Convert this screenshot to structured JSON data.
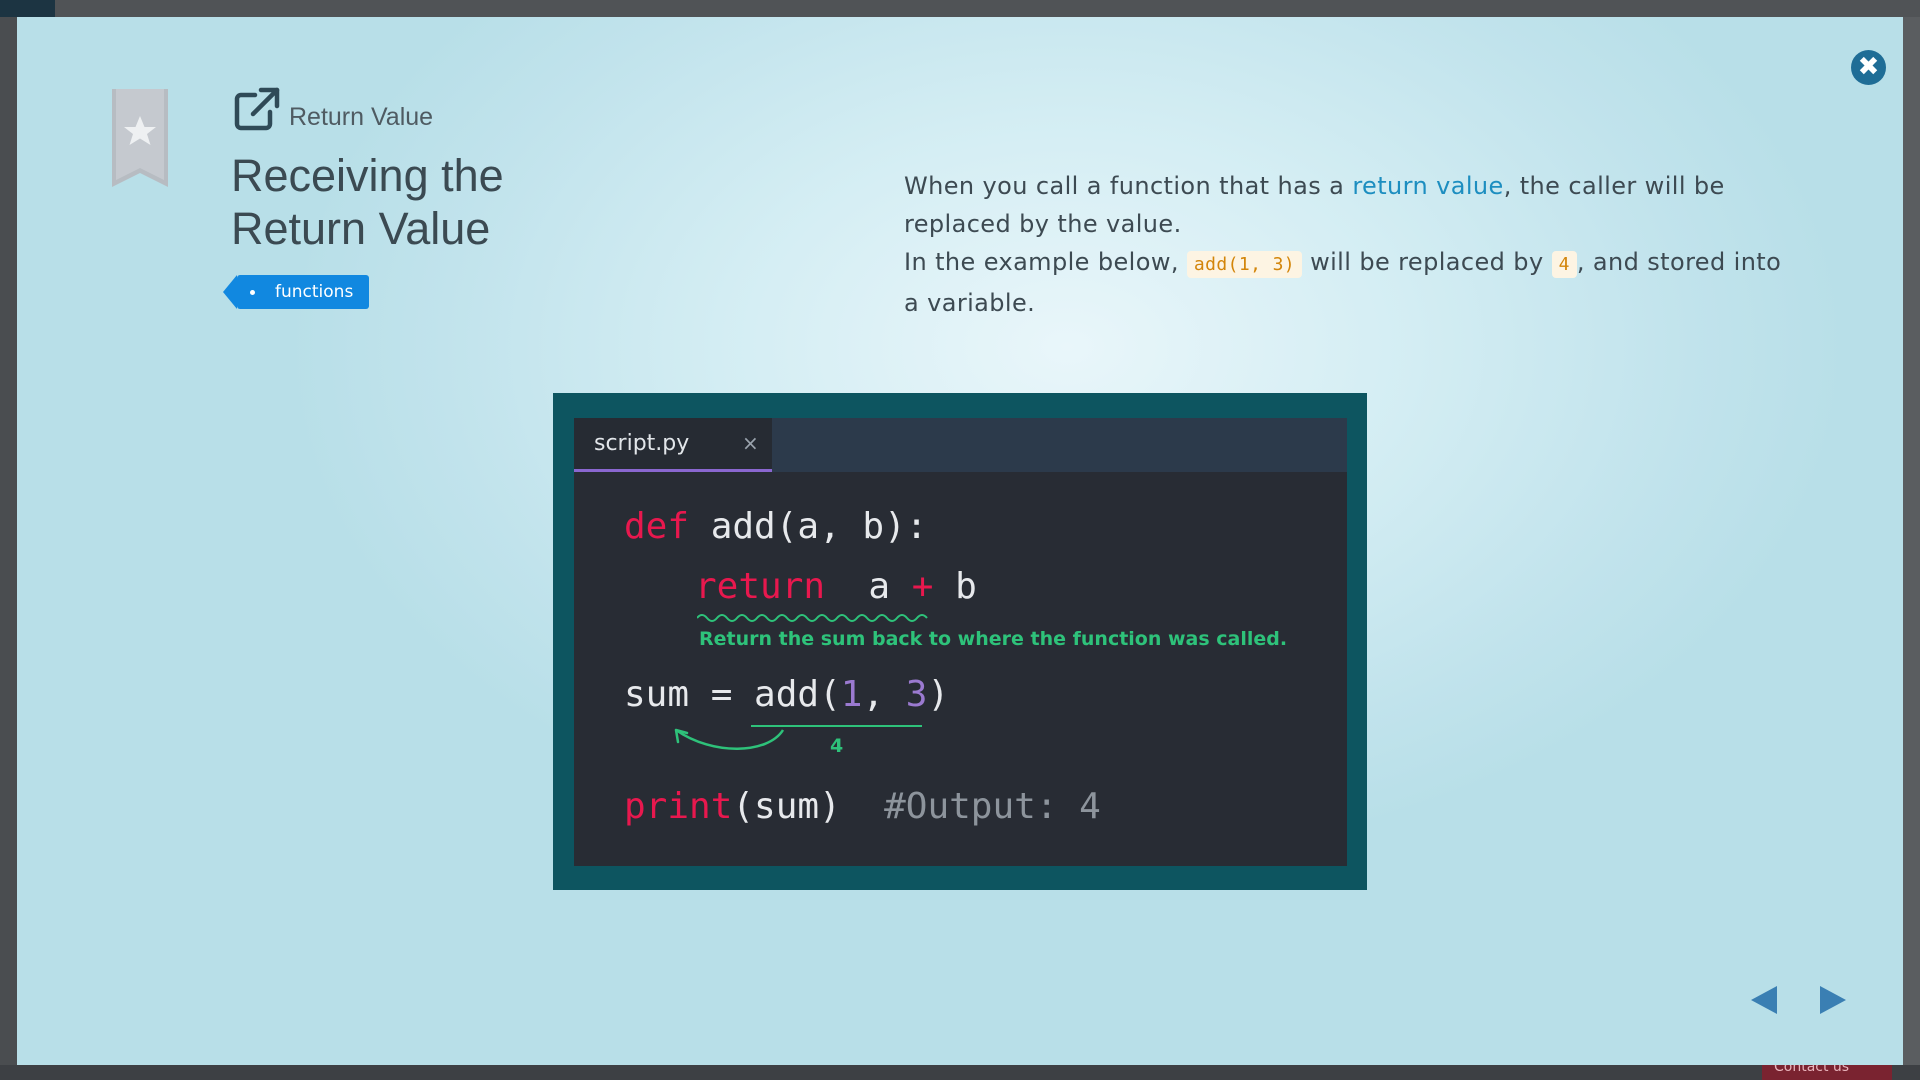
{
  "background": {
    "contact_label": "Contact us"
  },
  "modal": {
    "close_glyph": "✖",
    "lesson_label": "Return Value",
    "title": "Receiving the Return Value",
    "tag": "functions",
    "description": {
      "p1_before": "When you call a function that has a ",
      "p1_link": "return value",
      "p1_after": ", the caller will be replaced by the value.",
      "p2_before": "In the example below, ",
      "p2_code1": "add(1, 3)",
      "p2_mid": " will be replaced by ",
      "p2_code2": "4",
      "p2_after": ", and stored into a variable."
    }
  },
  "editor": {
    "tab_name": "script.py",
    "tab_close": "×",
    "line1": {
      "kw": "def",
      "rest": " add(a, b):"
    },
    "line2": {
      "kw": "return",
      "a": "  a ",
      "op": "+",
      "b": " b"
    },
    "annotation": "Return the sum back to where the function was called.",
    "line3": {
      "lhs": "sum = add(",
      "n1": "1",
      "comma": ", ",
      "n2": "3",
      "close": ")"
    },
    "result_label": "4",
    "line4": {
      "fn": "print",
      "args": "(sum)",
      "comment": "  #Output: 4"
    }
  },
  "colors": {
    "accent_link": "#1d8ec0",
    "tag_bg": "#1188e0",
    "keyword": "#e8184e",
    "number": "#9b7ad0",
    "annotation_green": "#2ec27a",
    "frame_teal": "#0d5560"
  },
  "icons": {
    "close": "close-icon",
    "bookmark": "bookmark-star-icon",
    "external": "external-link-icon",
    "prev": "prev-arrow-icon",
    "next": "next-arrow-icon"
  }
}
